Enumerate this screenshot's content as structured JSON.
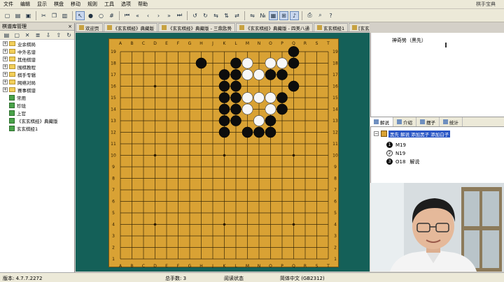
{
  "menu": {
    "items": [
      "文件",
      "编辑",
      "显示",
      "棋盘",
      "移动",
      "规则",
      "工具",
      "选项",
      "帮助"
    ],
    "app_title": "棋手宝典"
  },
  "left_panel": {
    "title": "棋谱库管理",
    "close": "×",
    "folders": [
      {
        "label": "业余棋局",
        "type": "folder"
      },
      {
        "label": "中外名谱",
        "type": "folder"
      },
      {
        "label": "其他棋谱",
        "type": "folder"
      },
      {
        "label": "围棋教程",
        "type": "folder"
      },
      {
        "label": "棋手专辑",
        "type": "folder"
      },
      {
        "label": "网络对局",
        "type": "folder"
      },
      {
        "label": "赛事棋谱",
        "type": "folder"
      },
      {
        "label": "常用",
        "type": "book"
      },
      {
        "label": "珍珑",
        "type": "book"
      },
      {
        "label": "上官",
        "type": "book"
      },
      {
        "label": "《玄玄棋经》典藏版",
        "type": "book"
      },
      {
        "label": "玄玄棋经1",
        "type": "book"
      }
    ]
  },
  "tabs": [
    {
      "label": "欢迎页"
    },
    {
      "label": "《玄玄棋经》典藏版"
    },
    {
      "label": "《玄玄棋经》典藏版 - 三鼎匙势"
    },
    {
      "label": "《玄玄棋经》典藏版 - 四美八通"
    },
    {
      "label": "玄玄棋经1"
    },
    {
      "label": "[玄玄棋经1] - 神奇势"
    },
    {
      "label": "新建棋谱 1*"
    }
  ],
  "board": {
    "columns": [
      "A",
      "B",
      "C",
      "D",
      "E",
      "F",
      "G",
      "H",
      "J",
      "K",
      "L",
      "M",
      "N",
      "O",
      "P",
      "Q",
      "R",
      "S",
      "T"
    ],
    "rows": [
      "19",
      "18",
      "17",
      "16",
      "15",
      "14",
      "13",
      "12",
      "11",
      "10",
      "9",
      "8",
      "7",
      "6",
      "5",
      "4",
      "3",
      "2",
      "1"
    ],
    "black_stones": [
      "Q19",
      "H18",
      "L18",
      "P18",
      "Q18",
      "L17",
      "O17",
      "P17",
      "L16",
      "Q16",
      "L15",
      "P15",
      "L14",
      "P14",
      "L13",
      "N13",
      "O13",
      "M12",
      "N12",
      "O12",
      "K17",
      "K16",
      "K15",
      "K14",
      "K13",
      "K12"
    ],
    "white_stones": [
      "M18",
      "O18",
      "P18w",
      "M17",
      "N17",
      "M15",
      "N15",
      "O15",
      "M14",
      "O14",
      "N13w"
    ]
  },
  "comment": {
    "text": "神奇势（黑先）"
  },
  "right_tabs": [
    "解说",
    "介绍",
    "摆子",
    "统计"
  ],
  "branches": {
    "root_label": "黑先  解说  添加黑子  添加白子",
    "moves": [
      {
        "color": "black",
        "num": "1",
        "coord": "M19",
        "note": ""
      },
      {
        "color": "white",
        "num": "2",
        "coord": "N19",
        "note": ""
      },
      {
        "color": "black",
        "num": "3",
        "coord": "O18",
        "note": "解说"
      }
    ]
  },
  "statusbar": {
    "version": "版本: 4.7.7.2272",
    "moves": "总手数: 3",
    "mode": "阅读状态",
    "encoding": "简体中文 (GB2312)"
  }
}
